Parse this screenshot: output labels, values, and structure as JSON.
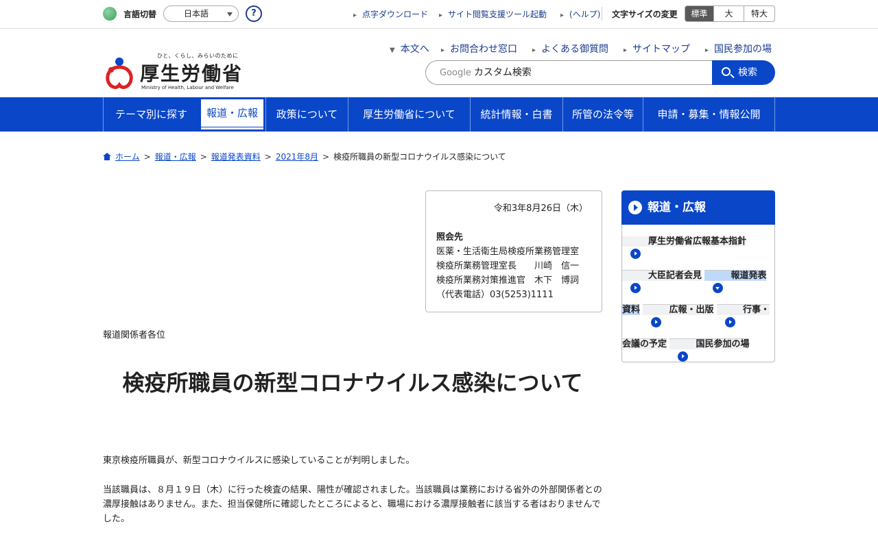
{
  "utility": {
    "lang_label": "言語切替",
    "lang_selected": "日本語",
    "help_glyph": "?",
    "braille_link": "点字ダウンロード",
    "support_tool_link": "サイト閲覧支援ツール起動",
    "support_help_link": "(ヘルプ)",
    "font_size_label": "文字サイズの変更",
    "font_sizes": [
      "標準",
      "大",
      "特大"
    ]
  },
  "logo": {
    "tagline": "ひと、くらし、みらいのために",
    "name": "厚生労働省",
    "english": "Ministry of Health, Labour and Welfare"
  },
  "header_links": [
    "本文へ",
    "お問合わせ窓口",
    "よくある御質問",
    "サイトマップ",
    "国民参加の場"
  ],
  "search": {
    "provider": "Google",
    "placeholder": "カスタム検索",
    "button_label": "検索"
  },
  "global_nav": [
    "テーマ別に探す",
    "報道・広報",
    "政策について",
    "厚生労働省について",
    "統計情報・白書",
    "所管の法令等",
    "申請・募集・情報公開"
  ],
  "breadcrumb": [
    "ホーム",
    "報道・広報",
    "報道発表資料",
    "2021年8月",
    "検疫所職員の新型コロナウイルス感染について"
  ],
  "info_box": {
    "date": "令和3年8月26日（木）",
    "contact_heading": "照会先",
    "contact_lines": [
      "医薬・生活衛生局検疫所業務管理室",
      "検疫所業務管理室長　　川崎　信一",
      "検疫所業務対策推進官　木下　博詞",
      "（代表電話）03(5253)1111"
    ]
  },
  "addressee": "報道関係者各位",
  "article_title": "検疫所職員の新型コロナウイルス感染について",
  "paragraphs": [
    "東京検疫所職員が、新型コロナウイルスに感染していることが判明しました。",
    "当該職員は、８月１９日（木）に行った検査の結果、陽性が確認されました。当該職員は業務における省外の外部関係者との濃厚接触はありません。また、担当保健所に確認したところによると、職場における濃厚接触者に該当する者はおりませんでした。"
  ],
  "side_nav": {
    "heading": "報道・広報",
    "items": [
      "厚生労働省広報基本指針",
      "大臣記者会見",
      "報道発表資料",
      "広報・出版",
      "行事・会議の予定",
      "国民参加の場"
    ],
    "current_index": 2
  },
  "colors": {
    "brand_blue": "#0a46c8",
    "current_item_bg": "#bfd9f9",
    "active_font_size_bg": "#595959"
  }
}
